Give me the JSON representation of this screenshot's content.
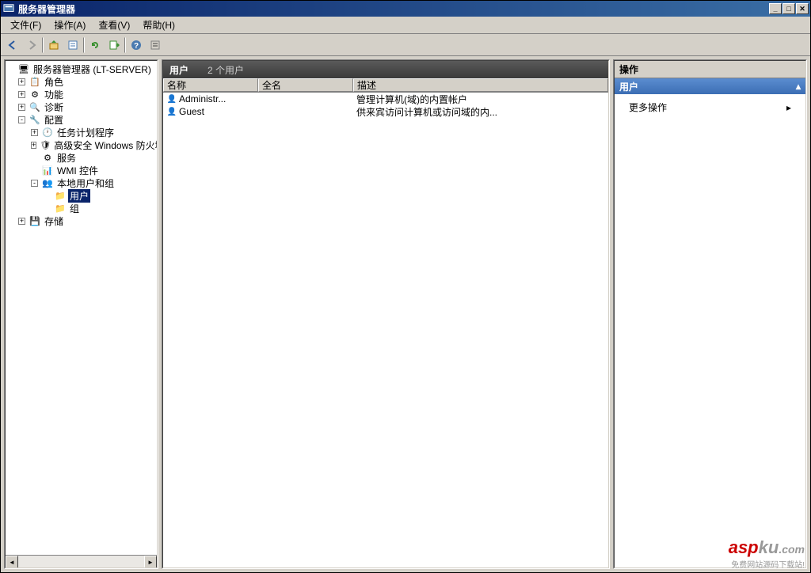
{
  "window": {
    "title": "服务器管理器"
  },
  "menus": {
    "file": "文件(F)",
    "action": "操作(A)",
    "view": "查看(V)",
    "help": "帮助(H)"
  },
  "tree": {
    "root": "服务器管理器 (LT-SERVER)",
    "roles": "角色",
    "features": "功能",
    "diagnostics": "诊断",
    "config": "配置",
    "tasksched": "任务计划程序",
    "firewall": "高级安全 Windows 防火墙",
    "services": "服务",
    "wmi": "WMI 控件",
    "localug": "本地用户和组",
    "users": "用户",
    "groups": "组",
    "storage": "存储"
  },
  "main": {
    "header": "用户",
    "count": "2 个用户",
    "cols": {
      "name": "名称",
      "full": "全名",
      "desc": "描述"
    },
    "rows": [
      {
        "name": "Administr...",
        "full": "",
        "desc": "管理计算机(域)的内置帐户"
      },
      {
        "name": "Guest",
        "full": "",
        "desc": "供来宾访问计算机或访问域的内..."
      }
    ]
  },
  "actions": {
    "title": "操作",
    "subtitle": "用户",
    "more": "更多操作"
  },
  "watermark": {
    "brand1": "asp",
    "brand2": "ku",
    "domain": ".com",
    "tag": "免费网站源码下载站!"
  }
}
